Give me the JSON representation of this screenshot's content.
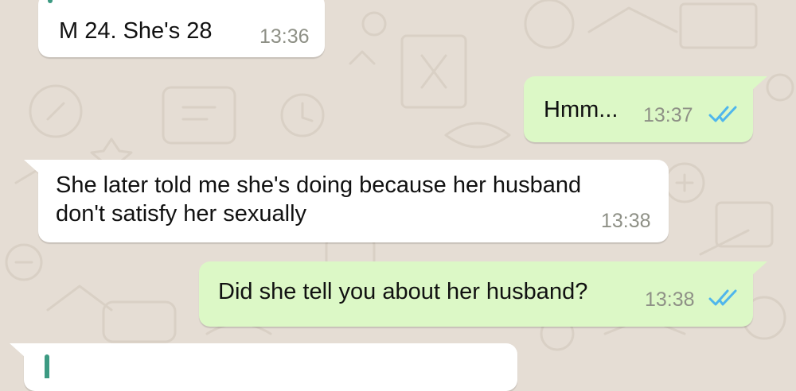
{
  "theme": {
    "wallpaper": "#e5ddd4",
    "incoming_bubble": "#ffffff",
    "outgoing_bubble": "#dcf8c6",
    "timestamp_color": "#8e9086",
    "read_tick_color": "#4fb6ec",
    "quote_accent": "#3c9a82"
  },
  "messages": [
    {
      "direction": "incoming",
      "text": "M 24. She's 28",
      "time": "13:36"
    },
    {
      "direction": "outgoing",
      "text": "Hmm...",
      "time": "13:37",
      "status": "read-double-check-icon"
    },
    {
      "direction": "incoming",
      "text": "She later told me she's doing because her husband\ndon't satisfy her sexually",
      "time": "13:38"
    },
    {
      "direction": "outgoing",
      "text": "Did she tell you about her husband?",
      "time": "13:38",
      "status": "read-double-check-icon"
    }
  ]
}
